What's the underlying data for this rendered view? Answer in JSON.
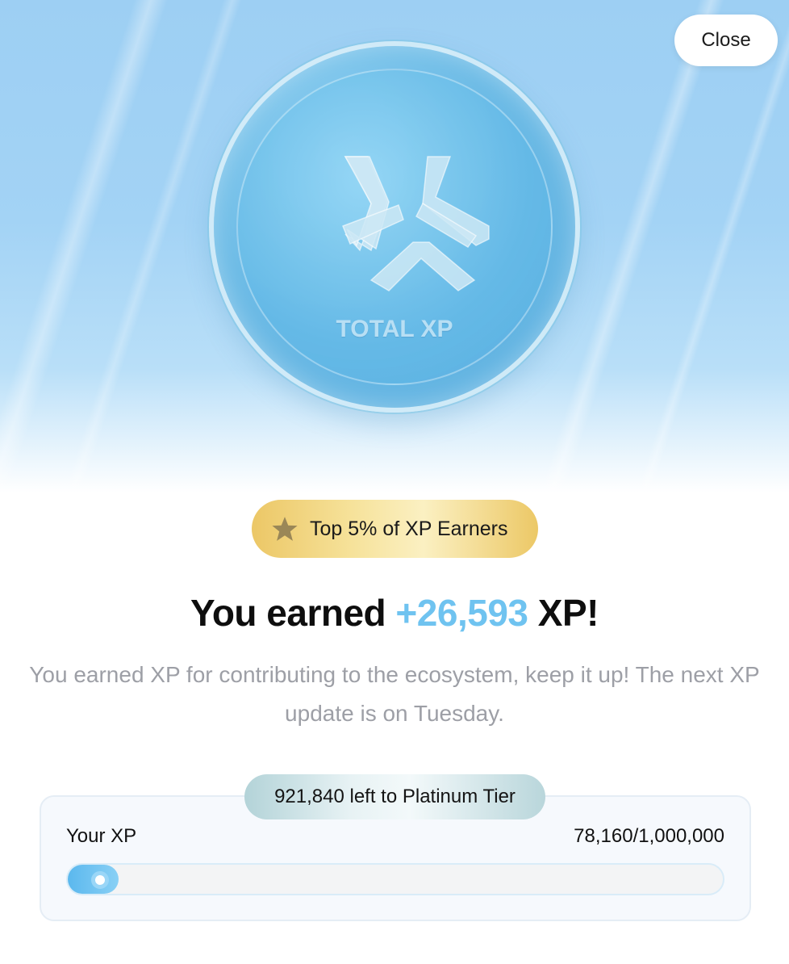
{
  "close_button": {
    "label": "Close"
  },
  "coin": {
    "label": "TOTAL XP",
    "icon": "xp-logo-icon"
  },
  "badge": {
    "icon": "star-icon",
    "text": "Top 5% of XP Earners"
  },
  "headline": {
    "prefix": "You earned ",
    "amount": "+26,593",
    "suffix": " XP!"
  },
  "description": "You earned XP for contributing to the ecosystem, keep it up! The next XP update is on Tuesday.",
  "progress": {
    "remaining_label": "921,840 left to Platinum Tier",
    "label": "Your XP",
    "value_text": "78,160/1,000,000",
    "current": 78160,
    "max": 1000000,
    "bar_fill_fraction": 0.078
  },
  "colors": {
    "accent": "#6fc3f0",
    "badge_gold": "#ecc766",
    "hero_blue": "#9dcff3",
    "muted_text": "#9d9fa6"
  }
}
